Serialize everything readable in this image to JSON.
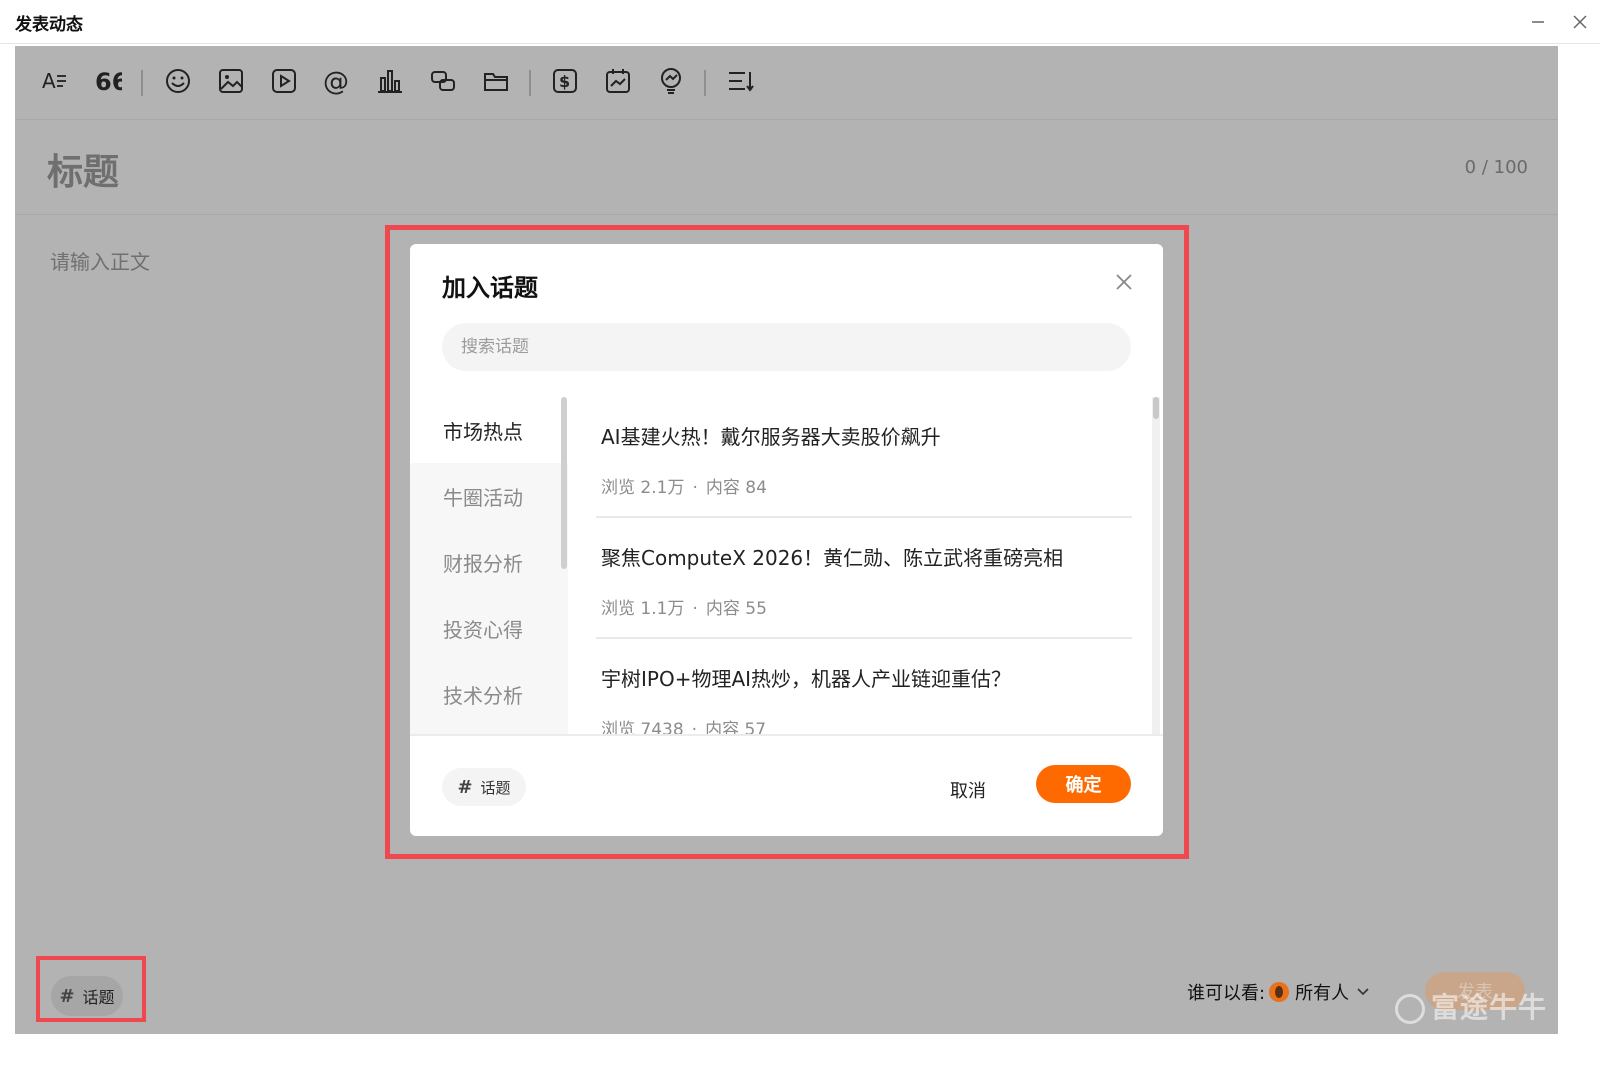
{
  "window": {
    "title": "发表动态"
  },
  "toolbar": {
    "icons": [
      "text-format-icon",
      "quote-icon",
      "emoji-icon",
      "image-icon",
      "video-icon",
      "mention-icon",
      "chart-icon",
      "link-icon",
      "folder-icon",
      "dollar-icon",
      "calendar-chart-icon",
      "idea-icon",
      "list-indent-icon"
    ]
  },
  "editor": {
    "title_placeholder": "标题",
    "title_count": "0 / 100",
    "body_placeholder": "请输入正文"
  },
  "bottom": {
    "topic_label": "话题",
    "visibility_label": "谁可以看:",
    "visibility_value": "所有人",
    "publish_label": "发表",
    "watermark": "富途牛牛"
  },
  "dialog": {
    "title": "加入话题",
    "search_placeholder": "搜索话题",
    "categories": [
      "市场热点",
      "牛圈活动",
      "财报分析",
      "投资心得",
      "技术分析"
    ],
    "topics": [
      {
        "title": "AI基建火热！戴尔服务器大卖股价飙升",
        "views": "浏览 2.1万",
        "content": "内容 84"
      },
      {
        "title": "聚焦ComputeX 2026！黄仁勋、陈立武将重磅亮相",
        "views": "浏览 1.1万",
        "content": "内容 55"
      },
      {
        "title": "宇树IPO+物理AI热炒，机器人产业链迎重估？",
        "views": "浏览 7438",
        "content": "内容 57"
      }
    ],
    "footer_topic_label": "话题",
    "cancel_label": "取消",
    "confirm_label": "确定"
  },
  "colors": {
    "accent": "#ff6a00",
    "highlight": "#f0484f",
    "overlay": "#b3b3b3"
  }
}
